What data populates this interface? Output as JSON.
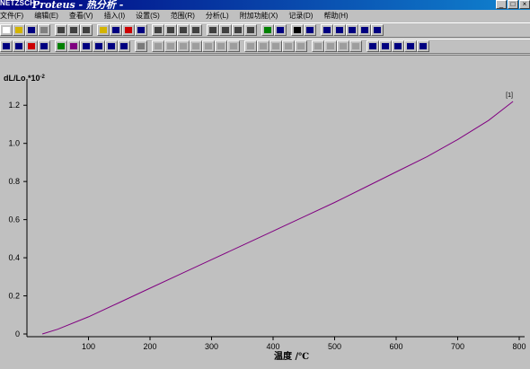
{
  "window": {
    "logo": "NETZSCH",
    "title": "Proteus - 热分析 -",
    "controls": [
      "_",
      "□",
      "×"
    ]
  },
  "menu": [
    "文件(F)",
    "编辑(E)",
    "查看(V)",
    "插入(I)",
    "设置(S)",
    "范围(R)",
    "分析(L)",
    "附加功能(X)",
    "记录(D)",
    "帮助(H)"
  ],
  "toolbar1": {
    "groups": [
      [
        {
          "icon": "new-file-icon",
          "color": "#ffffff",
          "enabled": true
        },
        {
          "icon": "open-folder-icon",
          "color": "#d4b400",
          "enabled": true
        },
        {
          "icon": "save-icon",
          "color": "#000080",
          "enabled": true
        },
        {
          "icon": "close-file-icon",
          "color": "#808080",
          "enabled": true
        }
      ],
      [
        {
          "icon": "print-preview-icon",
          "color": "#404040",
          "enabled": true
        },
        {
          "icon": "print-icon",
          "color": "#404040",
          "enabled": true
        },
        {
          "icon": "export-icon",
          "color": "#404040",
          "enabled": true
        }
      ],
      [
        {
          "icon": "text-annotation-icon",
          "color": "#d4b400",
          "enabled": true
        },
        {
          "icon": "table-icon",
          "color": "#000080",
          "enabled": true
        },
        {
          "icon": "list-icon",
          "color": "#cc0000",
          "enabled": true
        },
        {
          "icon": "bar-chart-icon",
          "color": "#000080",
          "enabled": true
        }
      ],
      [
        {
          "icon": "delete-curve-icon",
          "color": "#404040",
          "enabled": true
        },
        {
          "icon": "expand-x-icon",
          "color": "#404040",
          "enabled": true
        },
        {
          "icon": "expand-y-icon",
          "color": "#404040",
          "enabled": true
        },
        {
          "icon": "zoom-fit-icon",
          "color": "#404040",
          "enabled": true
        }
      ],
      [
        {
          "icon": "zoom-in-icon",
          "color": "#404040",
          "enabled": true
        },
        {
          "icon": "zoom-y-icon",
          "color": "#404040",
          "enabled": true
        },
        {
          "icon": "zoom-xy-icon",
          "color": "#404040",
          "enabled": true
        },
        {
          "icon": "zoom-out-icon",
          "color": "#404040",
          "enabled": true
        }
      ],
      [
        {
          "icon": "curve-up-icon",
          "color": "#008000",
          "enabled": true
        },
        {
          "icon": "curve-down-icon",
          "color": "#000080",
          "enabled": true
        }
      ],
      [
        {
          "icon": "pointer-icon",
          "color": "#000000",
          "enabled": true
        },
        {
          "icon": "help-pointer-icon",
          "color": "#000080",
          "enabled": true
        }
      ],
      [
        {
          "icon": "text-tool-icon",
          "color": "#000080",
          "enabled": true
        },
        {
          "icon": "rectangle-tool-icon",
          "color": "#000080",
          "enabled": true
        },
        {
          "icon": "frame-tool-icon",
          "color": "#000080",
          "enabled": true
        },
        {
          "icon": "ellipse-tool-icon",
          "color": "#000080",
          "enabled": true
        },
        {
          "icon": "line-tool-icon",
          "color": "#000080",
          "enabled": true
        }
      ]
    ]
  },
  "toolbar2": {
    "groups": [
      [
        {
          "icon": "curve-select-icon",
          "color": "#000080",
          "enabled": true
        },
        {
          "icon": "curve-edit-icon",
          "color": "#000080",
          "enabled": true
        },
        {
          "icon": "curve-scale-icon",
          "color": "#cc0000",
          "enabled": true
        },
        {
          "icon": "curve-shift-icon",
          "color": "#000080",
          "enabled": true
        }
      ],
      [
        {
          "icon": "settings-icon",
          "color": "#008000",
          "enabled": true
        },
        {
          "icon": "peak-icon",
          "color": "#800080",
          "enabled": true
        },
        {
          "icon": "onset-icon",
          "color": "#000080",
          "enabled": true
        },
        {
          "icon": "area-icon",
          "color": "#000080",
          "enabled": true
        },
        {
          "icon": "baseline-icon",
          "color": "#000080",
          "enabled": true
        },
        {
          "icon": "derivative-icon",
          "color": "#000080",
          "enabled": true
        }
      ],
      [
        {
          "icon": "refresh-icon",
          "color": "#404040",
          "enabled": false
        }
      ],
      [
        {
          "icon": "analysis-a-icon",
          "color": "#808080",
          "enabled": false
        },
        {
          "icon": "analysis-b-icon",
          "color": "#808080",
          "enabled": false
        },
        {
          "icon": "analysis-c-icon",
          "color": "#808080",
          "enabled": false
        },
        {
          "icon": "analysis-d-icon",
          "color": "#808080",
          "enabled": false
        },
        {
          "icon": "analysis-e-icon",
          "color": "#808080",
          "enabled": false
        },
        {
          "icon": "analysis-f-icon",
          "color": "#808080",
          "enabled": false
        },
        {
          "icon": "analysis-g-icon",
          "color": "#808080",
          "enabled": false
        }
      ],
      [
        {
          "icon": "analysis-h-icon",
          "color": "#808080",
          "enabled": false
        },
        {
          "icon": "analysis-i-icon",
          "color": "#808080",
          "enabled": false
        },
        {
          "icon": "analysis-j-icon",
          "color": "#808080",
          "enabled": false
        },
        {
          "icon": "analysis-k-icon",
          "color": "#808080",
          "enabled": false
        },
        {
          "icon": "analysis-l-icon",
          "color": "#808080",
          "enabled": false
        }
      ],
      [
        {
          "icon": "analysis-m-icon",
          "color": "#808080",
          "enabled": false
        },
        {
          "icon": "analysis-n-icon",
          "color": "#808080",
          "enabled": false
        },
        {
          "icon": "analysis-o-icon",
          "color": "#808080",
          "enabled": false
        },
        {
          "icon": "analysis-p-icon",
          "color": "#808080",
          "enabled": false
        }
      ],
      [
        {
          "icon": "glass-transition-icon",
          "color": "#000080",
          "enabled": true
        },
        {
          "icon": "step-icon",
          "color": "#000080",
          "enabled": true
        },
        {
          "icon": "expansion-coefficient-icon",
          "color": "#000080",
          "enabled": true
        },
        {
          "icon": "sintering-icon",
          "color": "#000080",
          "enabled": true
        },
        {
          "icon": "dilatometer-icon",
          "color": "#000080",
          "enabled": true
        }
      ]
    ]
  },
  "chart_data": {
    "type": "line",
    "ylabel": "dL/Lo *10",
    "ylabel_exponent": "-2",
    "xlabel": "温度 /℃",
    "xlim": [
      0,
      800
    ],
    "ylim": [
      0,
      1.3
    ],
    "xticks": [
      100,
      200,
      300,
      400,
      500,
      600,
      700,
      800
    ],
    "yticks": [
      0,
      0.2,
      0.4,
      0.6,
      0.8,
      1.0,
      1.2
    ],
    "ytick_labels": [
      "0",
      "0.2",
      "0.4",
      "0.6",
      "0.8",
      "1.0",
      "1.2"
    ],
    "grid": false,
    "line_color": "#800080",
    "series": [
      {
        "label": "[1]",
        "x": [
          25,
          50,
          100,
          150,
          200,
          250,
          300,
          350,
          400,
          450,
          500,
          550,
          600,
          650,
          700,
          750,
          790
        ],
        "y": [
          0.0,
          0.025,
          0.09,
          0.165,
          0.24,
          0.315,
          0.39,
          0.465,
          0.54,
          0.615,
          0.69,
          0.77,
          0.85,
          0.93,
          1.02,
          1.12,
          1.22
        ]
      }
    ]
  }
}
